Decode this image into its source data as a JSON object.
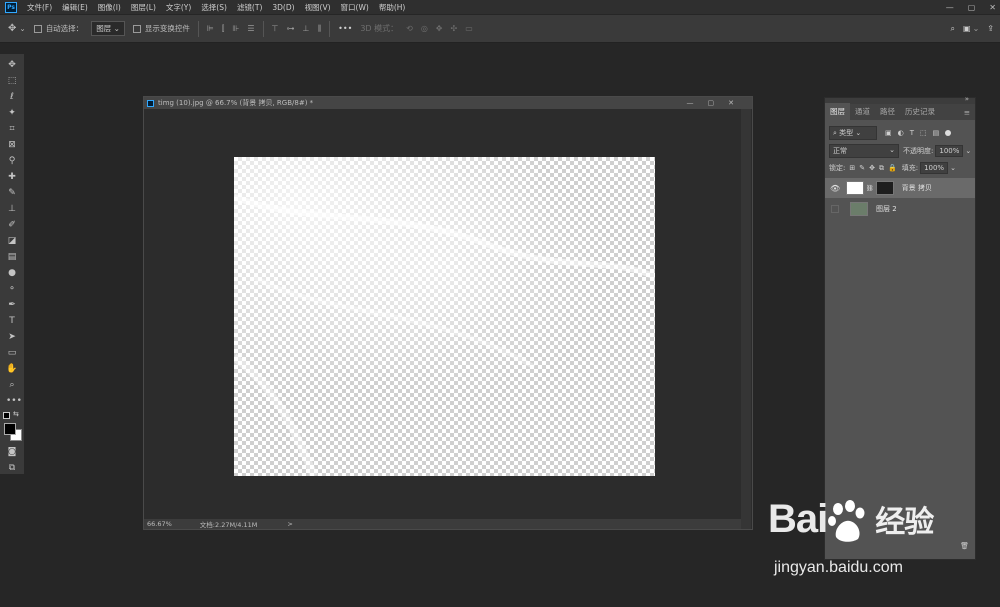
{
  "app": {
    "logo_text": "Ps",
    "menu": [
      "文件(F)",
      "编辑(E)",
      "图像(I)",
      "图层(L)",
      "文字(Y)",
      "选择(S)",
      "滤镜(T)",
      "3D(D)",
      "视图(V)",
      "窗口(W)",
      "帮助(H)"
    ],
    "window_controls": [
      "—",
      "▢",
      "✕"
    ]
  },
  "options": {
    "auto_select_label": "自动选择：",
    "auto_select_value": "图层",
    "show_transform_label": "显示变换控件",
    "more": "•••",
    "mode_3d_label": "3D 模式："
  },
  "document": {
    "title": "timg (10).jpg @ 66.7% (背景 拷贝, RGB/8#) *",
    "controls": [
      "—",
      "▢",
      "✕"
    ],
    "zoom": "66.67%",
    "doc_info": "文档:2.27M/4.11M",
    "status_arrow": ">"
  },
  "layers_panel": {
    "collapse": "»",
    "menu_icon": "≡",
    "tabs": [
      "图层",
      "通道",
      "路径",
      "历史记录"
    ],
    "filter_kind": "类型",
    "blend_mode": "正常",
    "opacity_label": "不透明度:",
    "opacity_value": "100%",
    "lock_label": "锁定:",
    "fill_label": "填充:",
    "fill_value": "100%",
    "layers": [
      {
        "name": "背景 拷贝",
        "visible": true,
        "selected": true
      },
      {
        "name": "图层 2",
        "visible": false,
        "selected": false
      }
    ]
  },
  "watermark": {
    "brand": "Bai",
    "brand_suffix": "经验",
    "url": "jingyan.baidu.com"
  }
}
